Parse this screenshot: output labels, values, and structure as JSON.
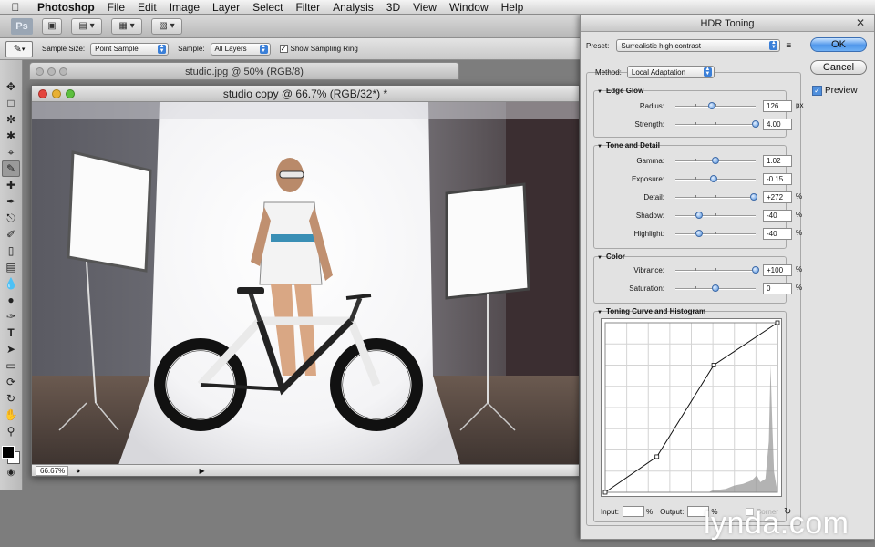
{
  "menubar": {
    "app": "Photoshop",
    "items": [
      "File",
      "Edit",
      "Image",
      "Layer",
      "Select",
      "Filter",
      "Analysis",
      "3D",
      "View",
      "Window",
      "Help"
    ]
  },
  "appbar": {
    "logo": "Ps",
    "buttons": [
      "screen-mode",
      "arrange-documents",
      "view-extras",
      "screen-layout"
    ]
  },
  "options": {
    "sample_size_label": "Sample Size:",
    "sample_size_value": "Point Sample",
    "sample_label": "Sample:",
    "sample_value": "All Layers",
    "sampling_ring_label": "Show Sampling Ring",
    "sampling_ring_checked": true
  },
  "tools": [
    "move-tool",
    "marquee-tool",
    "lasso-tool",
    "quick-selection-tool",
    "crop-tool",
    "eyedropper-tool",
    "healing-brush-tool",
    "brush-tool",
    "clone-stamp-tool",
    "history-brush-tool",
    "eraser-tool",
    "gradient-tool",
    "blur-tool",
    "dodge-tool",
    "pen-tool",
    "type-tool",
    "path-selection-tool",
    "shape-tool",
    "3d-rotate-tool",
    "3d-orbit-tool",
    "hand-tool",
    "zoom-tool"
  ],
  "documents": {
    "back_title": "studio.jpg @ 50% (RGB/8)",
    "front_title": "studio copy @ 66.7% (RGB/32*) *",
    "zoom": "66.67%"
  },
  "hdr_dialog": {
    "title": "HDR Toning",
    "preset_label": "Preset:",
    "preset_value": "Surrealistic high contrast",
    "method_label": "Method:",
    "method_value": "Local Adaptation",
    "ok_label": "OK",
    "cancel_label": "Cancel",
    "preview_label": "Preview",
    "preview_checked": true,
    "edge_glow": {
      "title": "Edge Glow",
      "radius": {
        "label": "Radius:",
        "value": "126",
        "unit": "px",
        "position": 0.45
      },
      "strength": {
        "label": "Strength:",
        "value": "4.00",
        "unit": "",
        "position": 1.0
      }
    },
    "tone_detail": {
      "title": "Tone and Detail",
      "gamma": {
        "label": "Gamma:",
        "value": "1.02",
        "unit": "",
        "position": 0.5
      },
      "exposure": {
        "label": "Exposure:",
        "value": "-0.15",
        "unit": "",
        "position": 0.48
      },
      "detail": {
        "label": "Detail:",
        "value": "+272",
        "unit": "%",
        "position": 0.98
      },
      "shadow": {
        "label": "Shadow:",
        "value": "-40",
        "unit": "%",
        "position": 0.3
      },
      "highlight": {
        "label": "Highlight:",
        "value": "-40",
        "unit": "%",
        "position": 0.3
      }
    },
    "color": {
      "title": "Color",
      "vibrance": {
        "label": "Vibrance:",
        "value": "+100",
        "unit": "%",
        "position": 1.0
      },
      "saturation": {
        "label": "Saturation:",
        "value": "0",
        "unit": "%",
        "position": 0.5
      }
    },
    "curve": {
      "title": "Toning Curve and Histogram",
      "input_label": "Input:",
      "input_unit": "%",
      "output_label": "Output:",
      "output_unit": "%",
      "corner_label": "Corner",
      "points": [
        [
          0,
          0
        ],
        [
          30,
          21
        ],
        [
          63,
          75
        ],
        [
          100,
          100
        ]
      ]
    }
  },
  "watermark": "lynda.com"
}
